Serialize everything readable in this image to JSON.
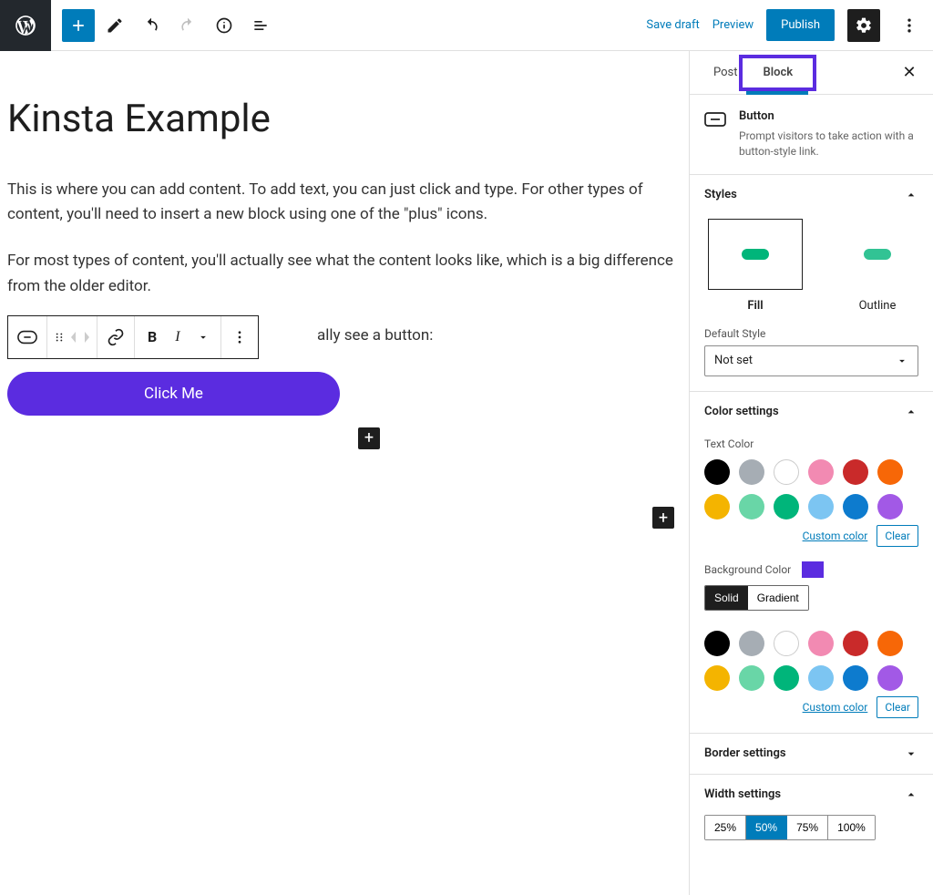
{
  "topbar": {
    "save_draft": "Save draft",
    "preview": "Preview",
    "publish": "Publish"
  },
  "editor": {
    "title": "Kinsta Example",
    "para1": "This is where you can add content. To add text, you can just click and type. For other types of content, you'll need to insert a new block using one of the \"plus\" icons.",
    "para2": "For most types of content, you'll actually see what the content looks like, which is a big difference from the older editor.",
    "button_intro_tail": "ally see a button:",
    "button_label": "Click Me"
  },
  "sidebar": {
    "tabs": {
      "post": "Post",
      "block": "Block"
    },
    "block_name": "Button",
    "block_desc": "Prompt visitors to take action with a button-style link.",
    "styles": {
      "title": "Styles",
      "fill": "Fill",
      "outline": "Outline",
      "default_label": "Default Style",
      "default_value": "Not set"
    },
    "color": {
      "title": "Color settings",
      "text_color_label": "Text Color",
      "bg_color_label": "Background Color",
      "solid": "Solid",
      "gradient": "Gradient",
      "custom": "Custom color",
      "clear": "Clear",
      "selected_bg": "#5B2CE0",
      "palette": [
        "#000000",
        "#A6ADB4",
        "#FFFFFF",
        "#F28AB2",
        "#C92A2A",
        "#F76707",
        "#F4B400",
        "#69D6A7",
        "#00B57A",
        "#7CC5F2",
        "#0D7BCE",
        "#A259E6"
      ]
    },
    "border": {
      "title": "Border settings"
    },
    "width": {
      "title": "Width settings",
      "options": [
        "25%",
        "50%",
        "75%",
        "100%"
      ],
      "selected": "50%"
    }
  }
}
